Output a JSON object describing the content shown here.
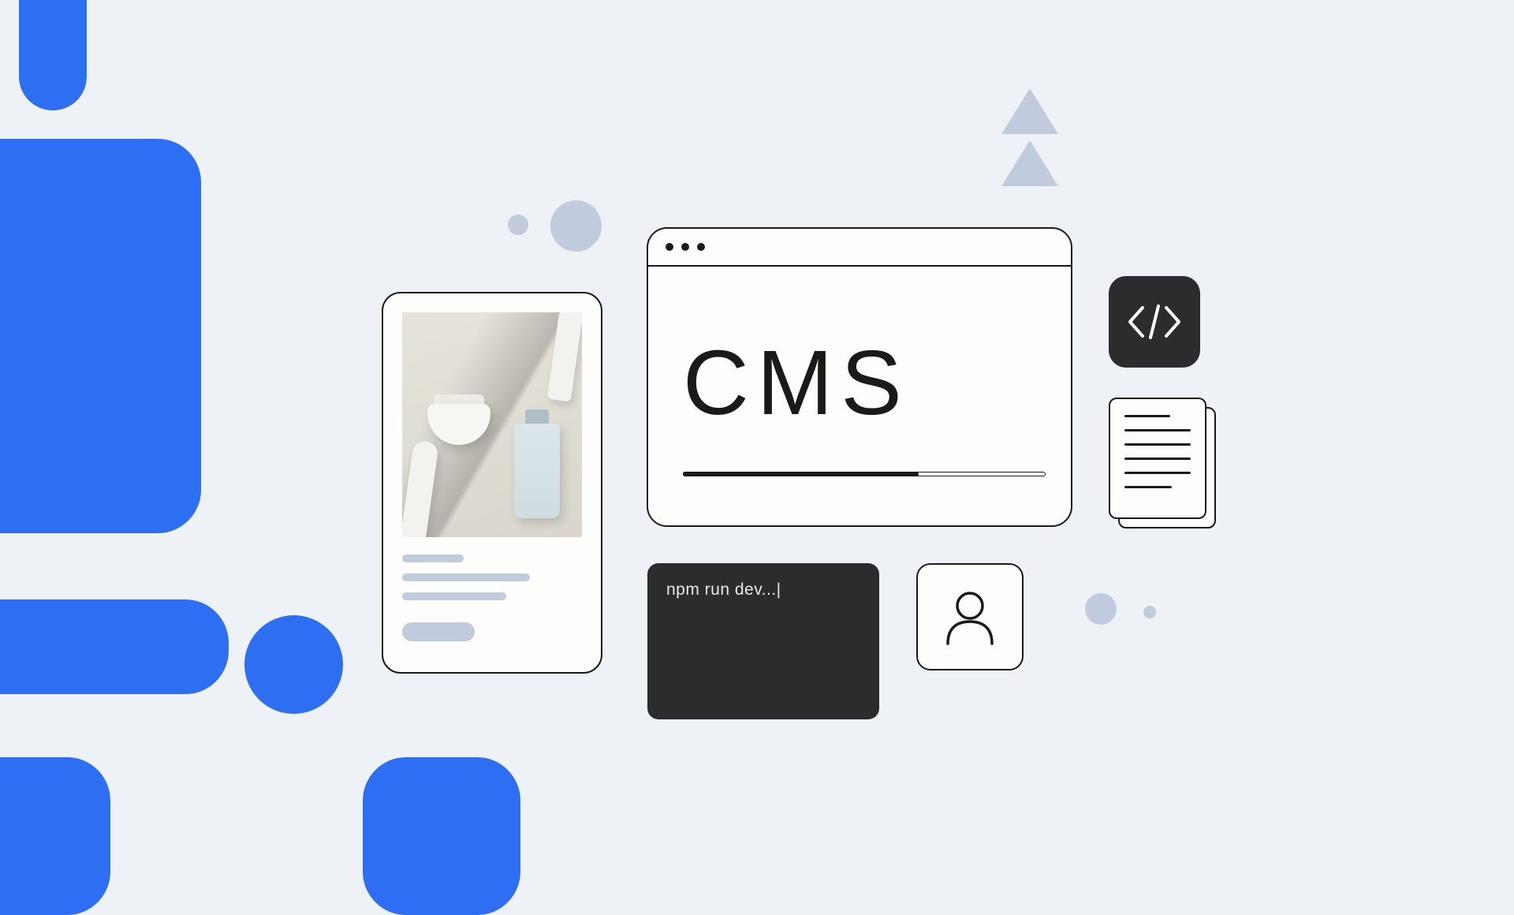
{
  "browser": {
    "title": "CMS"
  },
  "terminal": {
    "command": "npm run dev...|"
  },
  "icons": {
    "code": "code-icon",
    "user": "user-icon",
    "document": "document-icon"
  },
  "colors": {
    "accent_blue": "#2d6ef2",
    "slate": "#c0ccdd",
    "ink": "#1a1a1a",
    "terminal_bg": "#2c2c2e",
    "canvas_bg": "#eef1f5"
  }
}
